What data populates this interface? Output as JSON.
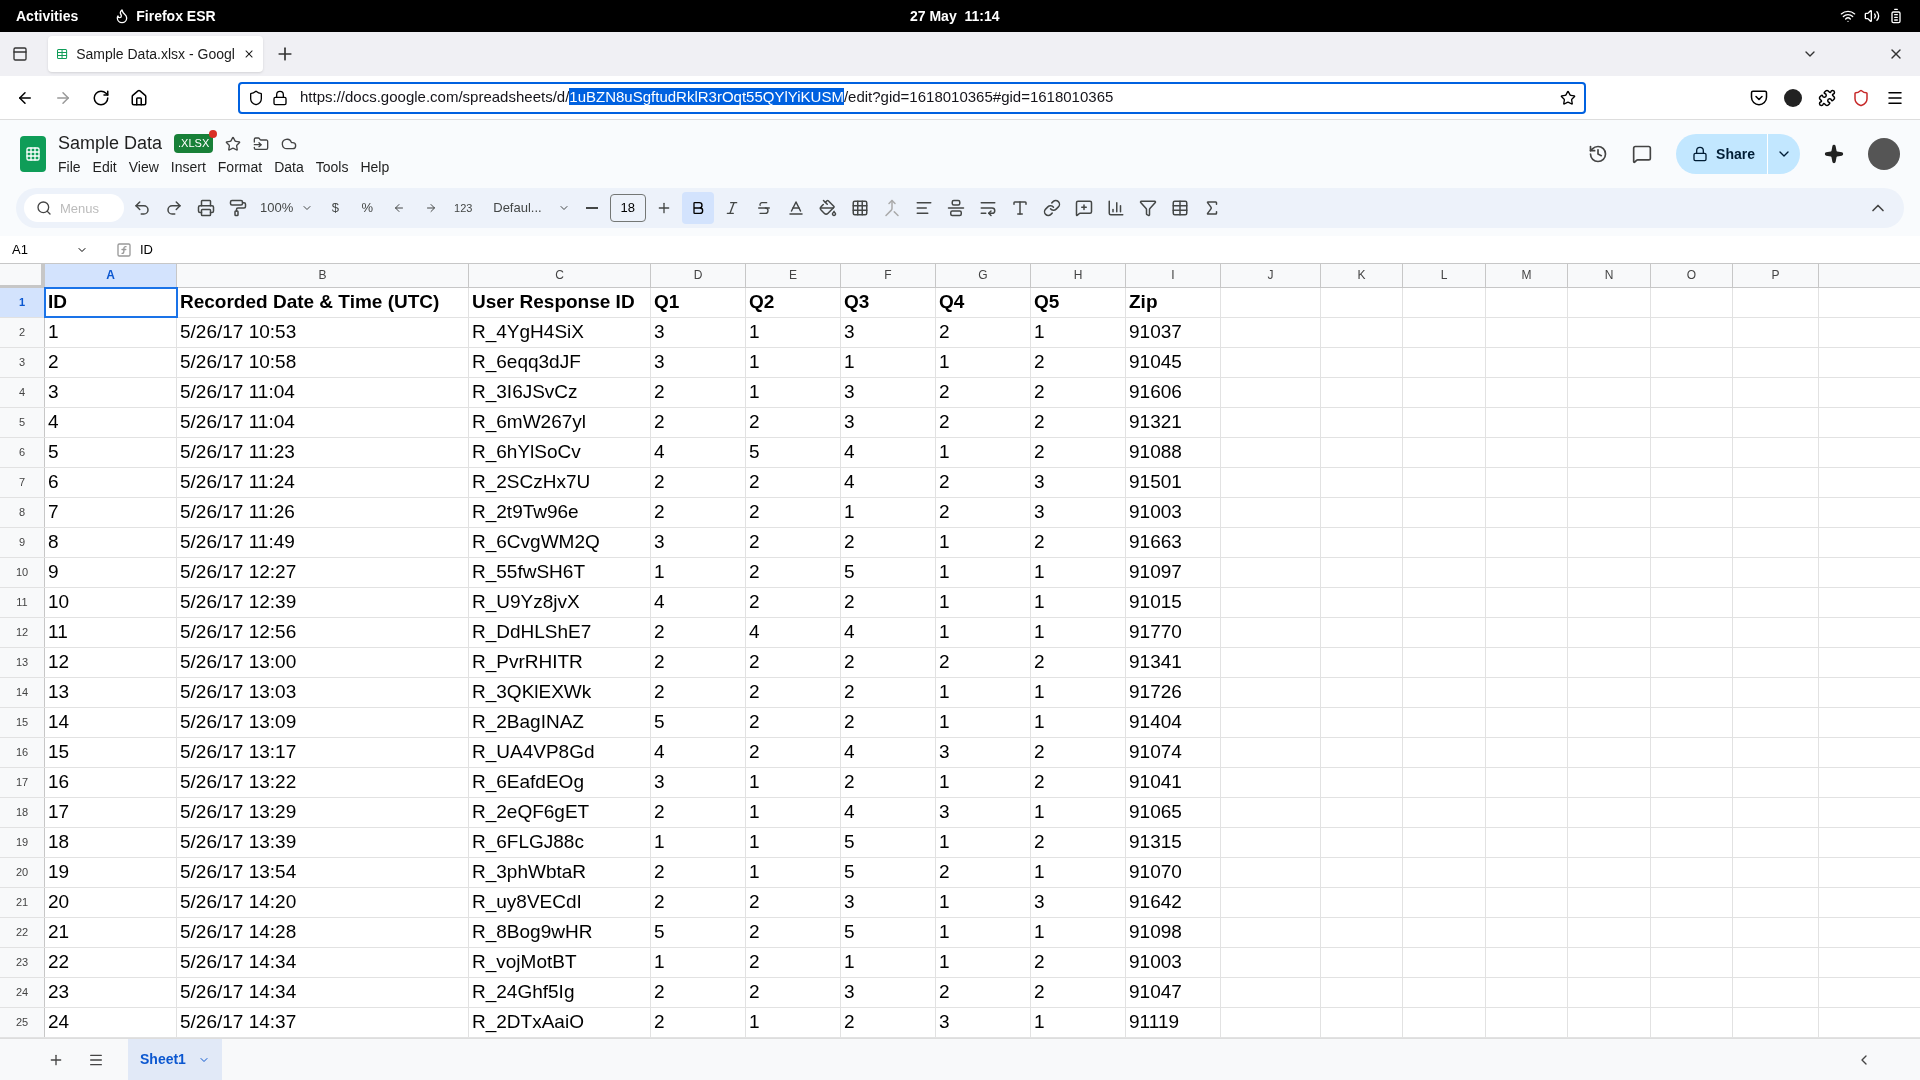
{
  "system_bar": {
    "activities": "Activities",
    "app": "Firefox ESR",
    "clock": "27 May  11:14"
  },
  "browser": {
    "tab_title": "Sample Data.xlsx - Googl",
    "url_start": "https://docs.google.com/spreadsheets/d/",
    "url_selected": "1uBZN8uSgftudRklR3rOqt55QYlYiKUSM",
    "url_end": "/edit?gid=1618010365#gid=1618010365"
  },
  "doc": {
    "title": "Sample Data",
    "badge": ".XLSX",
    "menu": [
      "File",
      "Edit",
      "View",
      "Insert",
      "Format",
      "Data",
      "Tools",
      "Help"
    ],
    "share": "Share"
  },
  "toolbar": {
    "search_placeholder": "Menus",
    "zoom": "100%",
    "currency": "$",
    "percent": "%",
    "number_format": "123",
    "font": "Defaul...",
    "font_size": "18",
    "bold": true
  },
  "formula_bar": {
    "cell": "A1",
    "content": "ID"
  },
  "sheet": {
    "columns": [
      {
        "label": "A",
        "selected": true
      },
      {
        "label": "B",
        "selected": false
      },
      {
        "label": "C",
        "selected": false
      },
      {
        "label": "D",
        "selected": false
      },
      {
        "label": "E",
        "selected": false
      },
      {
        "label": "F",
        "selected": false
      },
      {
        "label": "G",
        "selected": false
      },
      {
        "label": "H",
        "selected": false
      },
      {
        "label": "I",
        "selected": false
      },
      {
        "label": "J",
        "selected": false
      },
      {
        "label": "K",
        "selected": false
      },
      {
        "label": "L",
        "selected": false
      },
      {
        "label": "M",
        "selected": false
      },
      {
        "label": "N",
        "selected": false
      },
      {
        "label": "O",
        "selected": false
      },
      {
        "label": "P",
        "selected": false
      }
    ],
    "rows": [
      {
        "number": "1",
        "selected": true,
        "cells": [
          "ID",
          "Recorded Date & Time (UTC)",
          "User Response ID",
          "Q1",
          "Q2",
          "Q3",
          "Q4",
          "Q5",
          "Zip"
        ]
      },
      {
        "number": "2",
        "selected": false,
        "cells": [
          "1",
          "5/26/17 10:53",
          "R_4YgH4SiX",
          "3",
          "1",
          "3",
          "2",
          "1",
          "91037"
        ]
      },
      {
        "number": "3",
        "selected": false,
        "cells": [
          "2",
          "5/26/17 10:58",
          "R_6eqq3dJF",
          "3",
          "1",
          "1",
          "1",
          "2",
          "91045"
        ]
      },
      {
        "number": "4",
        "selected": false,
        "cells": [
          "3",
          "5/26/17 11:04",
          "R_3I6JSvCz",
          "2",
          "1",
          "3",
          "2",
          "2",
          "91606"
        ]
      },
      {
        "number": "5",
        "selected": false,
        "cells": [
          "4",
          "5/26/17 11:04",
          "R_6mW267yl",
          "2",
          "2",
          "3",
          "2",
          "2",
          "91321"
        ]
      },
      {
        "number": "6",
        "selected": false,
        "cells": [
          "5",
          "5/26/17 11:23",
          "R_6hYlSoCv",
          "4",
          "5",
          "4",
          "1",
          "2",
          "91088"
        ]
      },
      {
        "number": "7",
        "selected": false,
        "cells": [
          "6",
          "5/26/17 11:24",
          "R_2SCzHx7U",
          "2",
          "2",
          "4",
          "2",
          "3",
          "91501"
        ]
      },
      {
        "number": "8",
        "selected": false,
        "cells": [
          "7",
          "5/26/17 11:26",
          "R_2t9Tw96e",
          "2",
          "2",
          "1",
          "2",
          "3",
          "91003"
        ]
      },
      {
        "number": "9",
        "selected": false,
        "cells": [
          "8",
          "5/26/17 11:49",
          "R_6CvgWM2Q",
          "3",
          "2",
          "2",
          "1",
          "2",
          "91663"
        ]
      },
      {
        "number": "10",
        "selected": false,
        "cells": [
          "9",
          "5/26/17 12:27",
          "R_55fwSH6T",
          "1",
          "2",
          "5",
          "1",
          "1",
          "91097"
        ]
      },
      {
        "number": "11",
        "selected": false,
        "cells": [
          "10",
          "5/26/17 12:39",
          "R_U9Yz8jvX",
          "4",
          "2",
          "2",
          "1",
          "1",
          "91015"
        ]
      },
      {
        "number": "12",
        "selected": false,
        "cells": [
          "11",
          "5/26/17 12:56",
          "R_DdHLShE7",
          "2",
          "4",
          "4",
          "1",
          "1",
          "91770"
        ]
      },
      {
        "number": "13",
        "selected": false,
        "cells": [
          "12",
          "5/26/17 13:00",
          "R_PvrRHITR",
          "2",
          "2",
          "2",
          "2",
          "2",
          "91341"
        ]
      },
      {
        "number": "14",
        "selected": false,
        "cells": [
          "13",
          "5/26/17 13:03",
          "R_3QKlEXWk",
          "2",
          "2",
          "2",
          "1",
          "1",
          "91726"
        ]
      },
      {
        "number": "15",
        "selected": false,
        "cells": [
          "14",
          "5/26/17 13:09",
          "R_2BagINAZ",
          "5",
          "2",
          "2",
          "1",
          "1",
          "91404"
        ]
      },
      {
        "number": "16",
        "selected": false,
        "cells": [
          "15",
          "5/26/17 13:17",
          "R_UA4VP8Gd",
          "4",
          "2",
          "4",
          "3",
          "2",
          "91074"
        ]
      },
      {
        "number": "17",
        "selected": false,
        "cells": [
          "16",
          "5/26/17 13:22",
          "R_6EafdEOg",
          "3",
          "1",
          "2",
          "1",
          "2",
          "91041"
        ]
      },
      {
        "number": "18",
        "selected": false,
        "cells": [
          "17",
          "5/26/17 13:29",
          "R_2eQF6gET",
          "2",
          "1",
          "4",
          "3",
          "1",
          "91065"
        ]
      },
      {
        "number": "19",
        "selected": false,
        "cells": [
          "18",
          "5/26/17 13:39",
          "R_6FLGJ88c",
          "1",
          "1",
          "5",
          "1",
          "2",
          "91315"
        ]
      },
      {
        "number": "20",
        "selected": false,
        "cells": [
          "19",
          "5/26/17 13:54",
          "R_3phWbtaR",
          "2",
          "1",
          "5",
          "2",
          "1",
          "91070"
        ]
      },
      {
        "number": "21",
        "selected": false,
        "cells": [
          "20",
          "5/26/17 14:20",
          "R_uy8VECdI",
          "2",
          "2",
          "3",
          "1",
          "3",
          "91642"
        ]
      },
      {
        "number": "22",
        "selected": false,
        "cells": [
          "21",
          "5/26/17 14:28",
          "R_8Bog9wHR",
          "5",
          "2",
          "5",
          "1",
          "1",
          "91098"
        ]
      },
      {
        "number": "23",
        "selected": false,
        "cells": [
          "22",
          "5/26/17 14:34",
          "R_vojMotBT",
          "1",
          "2",
          "1",
          "1",
          "2",
          "91003"
        ]
      },
      {
        "number": "24",
        "selected": false,
        "cells": [
          "23",
          "5/26/17 14:34",
          "R_24Ghf5Ig",
          "2",
          "2",
          "3",
          "2",
          "2",
          "91047"
        ]
      },
      {
        "number": "25",
        "selected": false,
        "cells": [
          "24",
          "5/26/17 14:37",
          "R_2DTxAaiO",
          "2",
          "1",
          "2",
          "3",
          "1",
          "91119"
        ]
      }
    ]
  },
  "sheet_tabs": [
    {
      "label": "Sheet1",
      "selected": true
    }
  ]
}
